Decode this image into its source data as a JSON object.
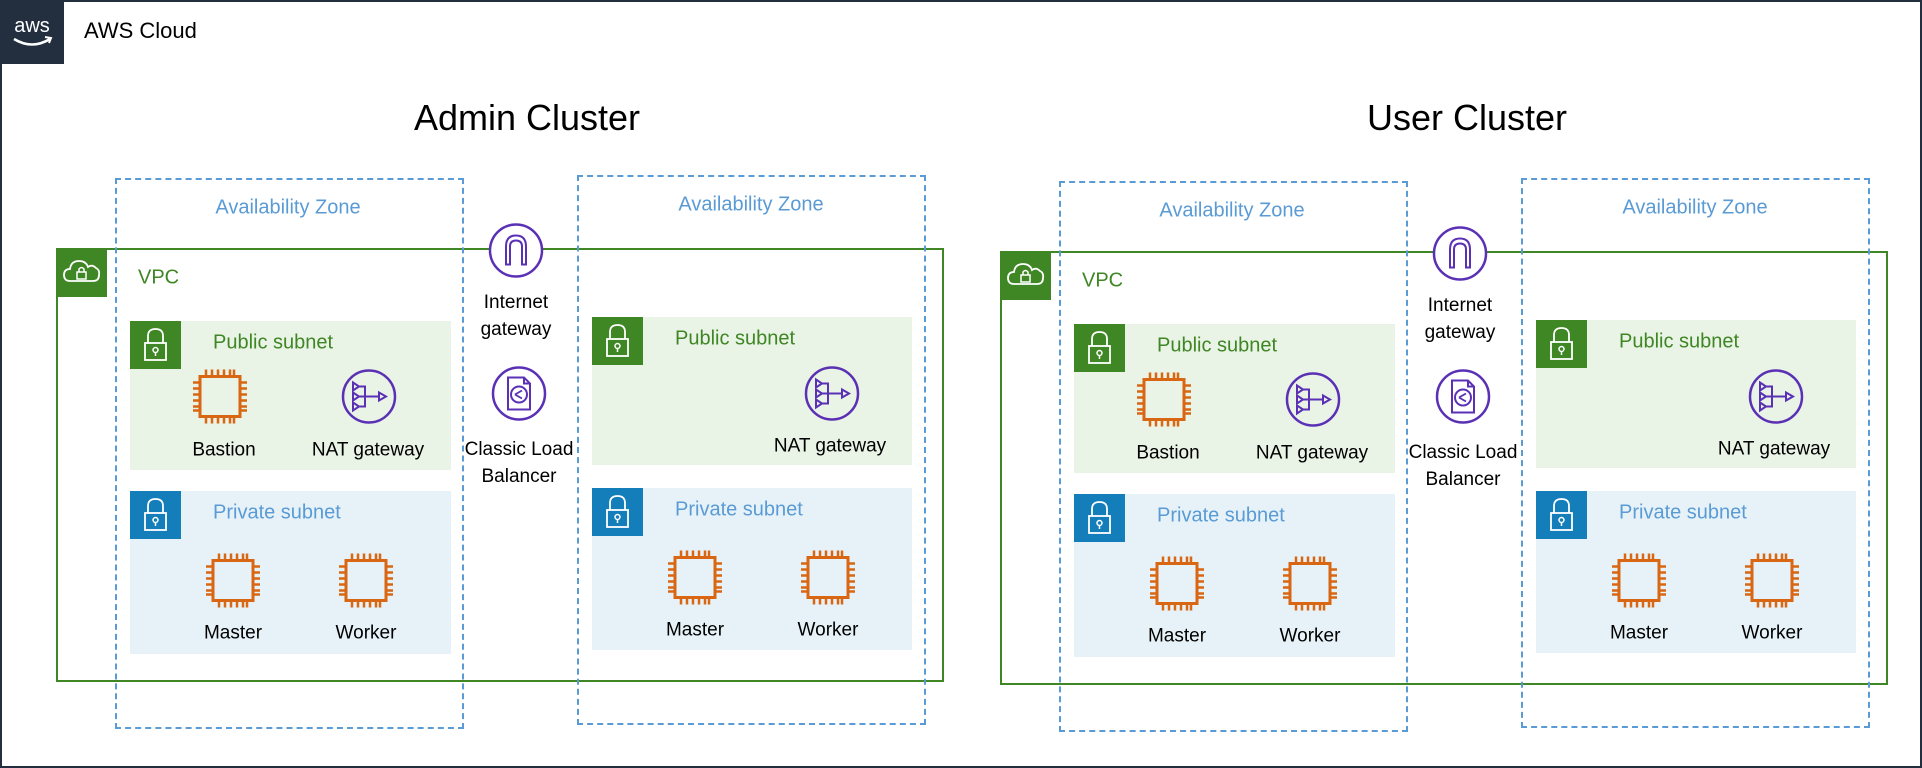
{
  "header": {
    "logo_text": "aws",
    "title": "AWS Cloud"
  },
  "colors": {
    "vpc_green": "#3F8624",
    "az_blue": "#5A9BD5",
    "private_blue": "#147EBA",
    "ec2_orange": "#D86613",
    "network_purple": "#5A30B5"
  },
  "clusters": [
    {
      "title": "Admin Cluster",
      "vpc_label": "VPC",
      "internet_gateway": {
        "label": "Internet gateway",
        "icon": "internet-gateway-icon"
      },
      "load_balancer": {
        "label_line1": "Classic Load",
        "label_line2": "Balancer",
        "icon": "classic-load-balancer-icon"
      },
      "zones": [
        {
          "label": "Availability Zone",
          "public_subnet": {
            "label": "Public subnet",
            "bastion": "Bastion",
            "nat": "NAT gateway"
          },
          "private_subnet": {
            "label": "Private subnet",
            "master": "Master",
            "worker": "Worker"
          }
        },
        {
          "label": "Availability Zone",
          "public_subnet": {
            "label": "Public subnet",
            "nat": "NAT gateway"
          },
          "private_subnet": {
            "label": "Private subnet",
            "master": "Master",
            "worker": "Worker"
          }
        }
      ]
    },
    {
      "title": "User Cluster",
      "vpc_label": "VPC",
      "internet_gateway": {
        "label": "Internet gateway",
        "icon": "internet-gateway-icon"
      },
      "load_balancer": {
        "label_line1": "Classic Load",
        "label_line2": "Balancer",
        "icon": "classic-load-balancer-icon"
      },
      "zones": [
        {
          "label": "Availability Zone",
          "public_subnet": {
            "label": "Public subnet",
            "bastion": "Bastion",
            "nat": "NAT gateway"
          },
          "private_subnet": {
            "label": "Private subnet",
            "master": "Master",
            "worker": "Worker"
          }
        },
        {
          "label": "Availability Zone",
          "public_subnet": {
            "label": "Public subnet",
            "nat": "NAT gateway"
          },
          "private_subnet": {
            "label": "Private subnet",
            "master": "Master",
            "worker": "Worker"
          }
        }
      ]
    }
  ]
}
